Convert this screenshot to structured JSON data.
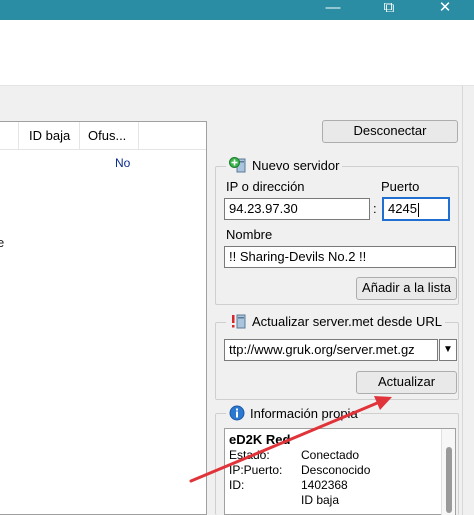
{
  "window": {
    "min_glyph": "—",
    "max_glyph": "⧉",
    "close_glyph": "✕"
  },
  "server_list": {
    "columns": [
      "ID baja",
      "Ofus..."
    ],
    "rows": [
      {
        "id_baja": "",
        "ofus": "No"
      }
    ],
    "edge_text": "e"
  },
  "disconnect_button": "Desconectar",
  "new_server": {
    "legend": "Nuevo servidor",
    "ip_label": "IP o dirección",
    "port_label": "Puerto",
    "ip_value": "94.23.97.30",
    "separator": ":",
    "port_value": "4245",
    "name_label": "Nombre",
    "name_value": "!! Sharing-Devils No.2 !!",
    "add_button": "Añadir a la lista"
  },
  "update_servermet": {
    "legend": "Actualizar server.met desde URL",
    "url_value": "ttp://www.gruk.org/server.met.gz",
    "dropdown_glyph": "▼",
    "update_button": "Actualizar"
  },
  "own_info": {
    "legend": "Información propia",
    "title": "eD2K Red",
    "rows": [
      {
        "key": "Estado:",
        "value": "Conectado"
      },
      {
        "key": "IP:Puerto:",
        "value": "Desconocido"
      },
      {
        "key": "ID:",
        "value": "1402368"
      },
      {
        "key": "",
        "value": "ID baja"
      }
    ]
  },
  "colors": {
    "titlebar": "#2a8da3",
    "arrow": "#e0343a",
    "focus": "#1f6fd1",
    "info_icon": "#2b78d0"
  },
  "icons": {
    "new_server": "green-plus-server-icon",
    "update": "red-exclamation-server-icon",
    "info": "blue-info-icon",
    "annotation": "red-arrow-annotation"
  }
}
